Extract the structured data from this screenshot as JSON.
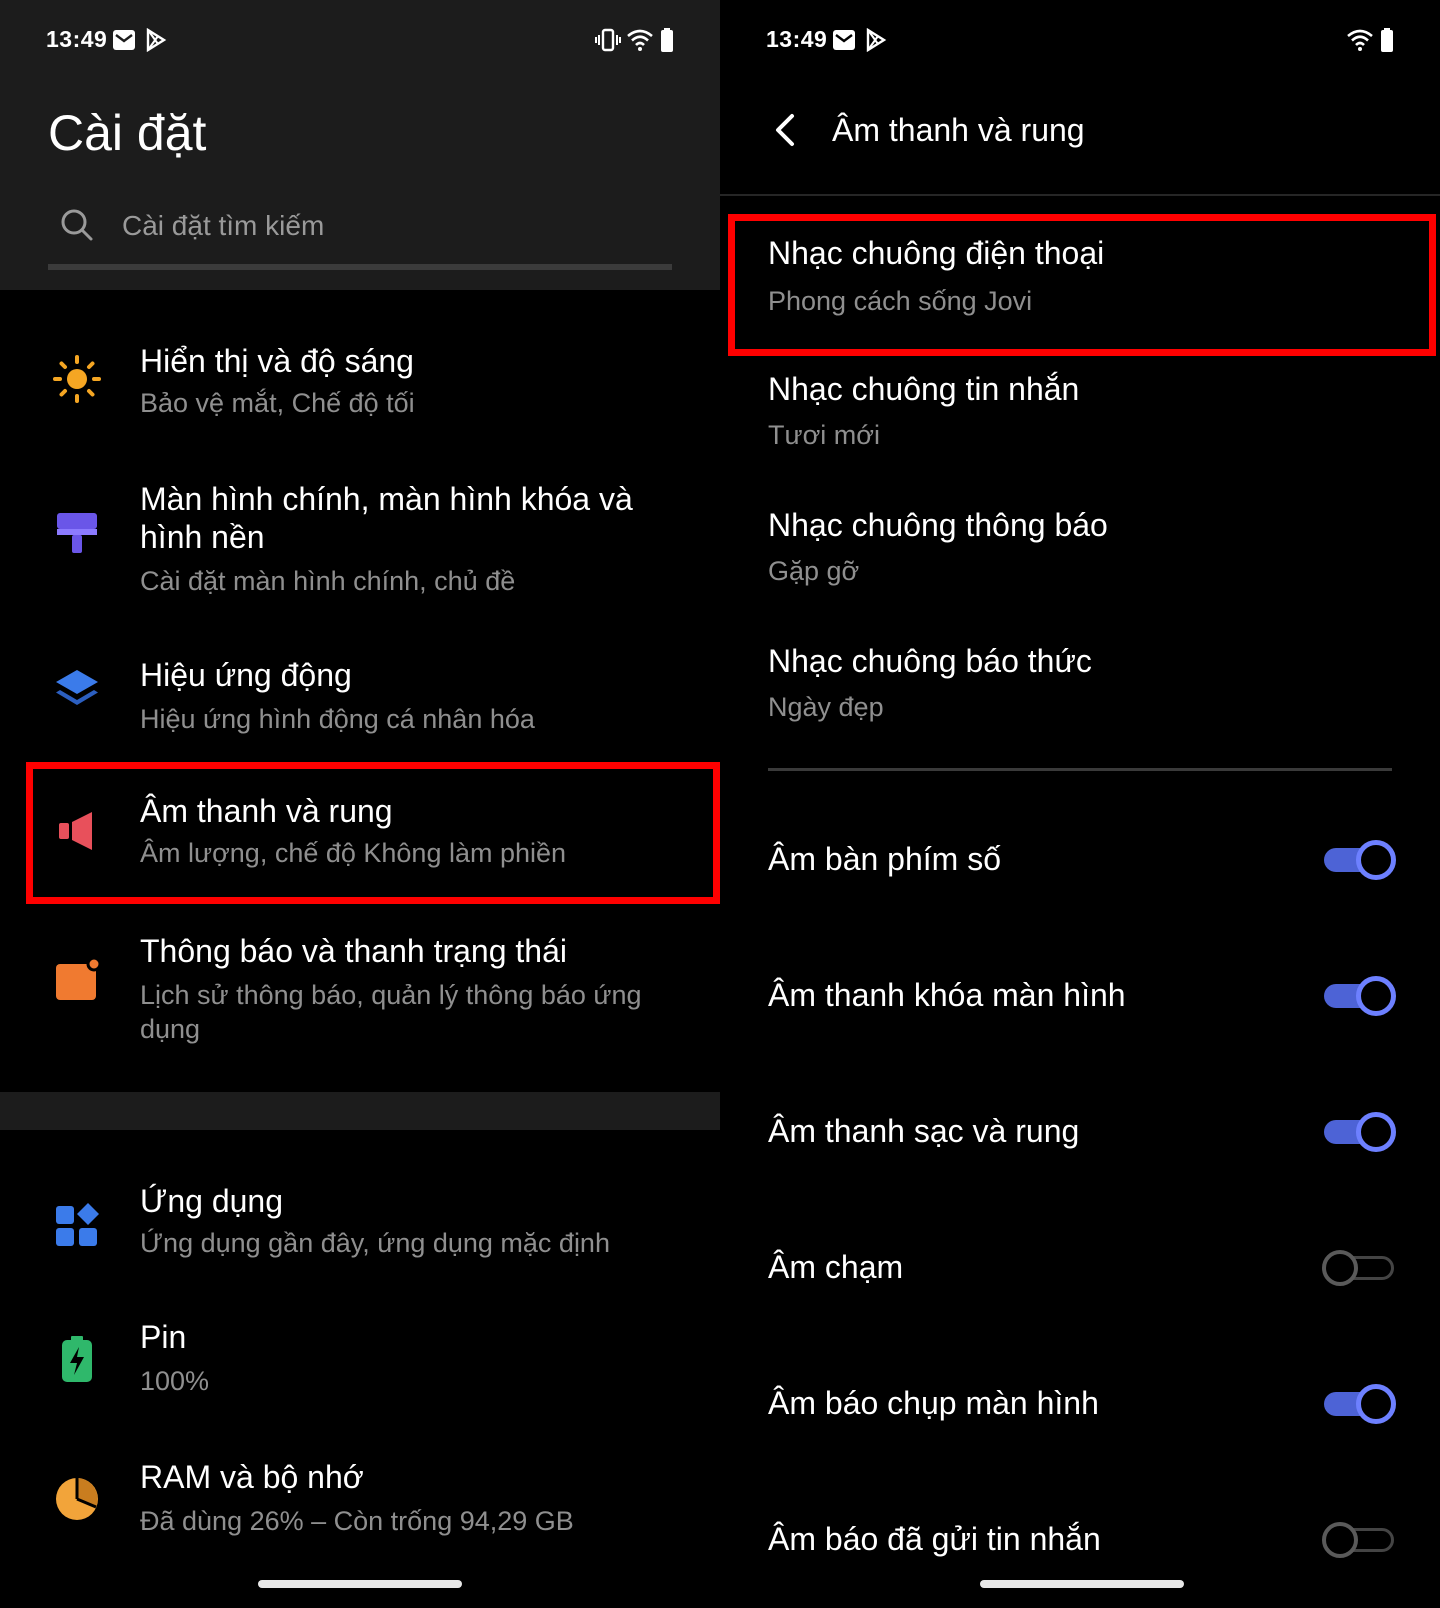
{
  "status_bar": {
    "time": "13:49"
  },
  "left": {
    "title": "Cài đặt",
    "search_placeholder": "Cài đặt tìm kiếm",
    "items": [
      {
        "title": "Hiển thị và độ sáng",
        "subtitle": "Bảo vệ mắt, Chế độ tối",
        "icon": "sun-icon"
      },
      {
        "title": "Màn hình chính, màn hình khóa và",
        "title2": "hình nền",
        "subtitle": "Cài đặt màn hình chính, chủ đề",
        "icon": "paint-roller-icon"
      },
      {
        "title": "Hiệu ứng động",
        "subtitle": "Hiệu ứng hình động cá nhân hóa",
        "icon": "layers-icon"
      },
      {
        "title": "Âm thanh và rung",
        "subtitle": "Âm lượng, chế độ Không làm phiền",
        "icon": "speaker-icon"
      },
      {
        "title": "Thông báo và thanh trạng thái",
        "subtitle": "Lịch sử thông báo, quản lý thông báo ứng",
        "subtitle2": "dụng",
        "icon": "notification-icon"
      },
      {
        "title": "Ứng dụng",
        "subtitle": "Ứng dụng gần đây, ứng dụng mặc định",
        "icon": "apps-icon"
      },
      {
        "title": "Pin",
        "subtitle": "100%",
        "icon": "battery-icon"
      },
      {
        "title": "RAM và bộ nhớ",
        "subtitle": "Đã dùng 26% – Còn trống 94,29 GB",
        "icon": "storage-pie-icon"
      }
    ]
  },
  "right": {
    "title": "Âm thanh và rung",
    "ringtones": [
      {
        "title": "Nhạc chuông điện thoại",
        "subtitle": "Phong cách sống Jovi"
      },
      {
        "title": "Nhạc chuông tin nhắn",
        "subtitle": "Tươi mới"
      },
      {
        "title": "Nhạc chuông thông báo",
        "subtitle": "Gặp gỡ"
      },
      {
        "title": "Nhạc chuông báo thức",
        "subtitle": "Ngày đẹp"
      }
    ],
    "toggles": [
      {
        "label": "Âm bàn phím số",
        "on": true
      },
      {
        "label": "Âm thanh khóa màn hình",
        "on": true
      },
      {
        "label": "Âm thanh sạc và rung",
        "on": true
      },
      {
        "label": "Âm chạm",
        "on": false
      },
      {
        "label": "Âm báo chụp màn hình",
        "on": true
      },
      {
        "label": "Âm báo đã gửi tin nhắn",
        "on": false
      }
    ]
  },
  "colors": {
    "accent": "#4d63d6",
    "highlight": "#ff0000",
    "subtitle": "#8f8f8f"
  }
}
